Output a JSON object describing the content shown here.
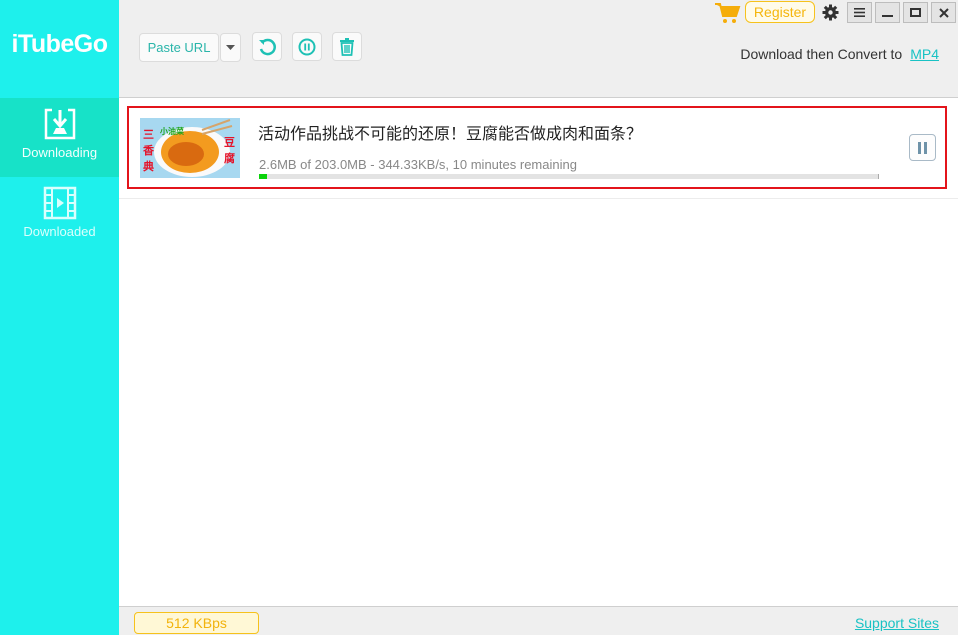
{
  "app": {
    "title": "iTubeGo"
  },
  "sidebar": {
    "items": [
      {
        "label": "Downloading",
        "icon": "download-icon",
        "active": true
      },
      {
        "label": "Downloaded",
        "icon": "film-icon",
        "active": false
      }
    ]
  },
  "toolbar": {
    "paste_url_label": "Paste URL",
    "dropdown_icon": "caret-down-icon",
    "retry_icon": "refresh-icon",
    "pause_all_icon": "pause-circle-icon",
    "delete_icon": "trash-icon"
  },
  "titlebar": {
    "cart_icon": "cart-icon",
    "register_label": "Register",
    "settings_icon": "gear-icon",
    "menu_icon": "hamburger-icon",
    "minimize_icon": "minimize-icon",
    "maximize_icon": "maximize-icon",
    "close_icon": "close-icon"
  },
  "convert": {
    "label": "Download then Convert to",
    "format": "MP4"
  },
  "downloads": [
    {
      "title": "活动作品挑战不可能的还原！豆腐能否做成肉和面条？",
      "status": "2.6MB of 203.0MB - 344.33KB/s, 10 minutes remaining",
      "progress_fraction": 0.013,
      "thumbnail_text": [
        "三香典",
        "小油菜",
        "豆腐"
      ]
    }
  ],
  "footer": {
    "speed_limit": "512 KBps",
    "support_label": "Support Sites"
  },
  "colors": {
    "sidebar": "#1ef0ec",
    "sidebar_active": "#17e2c8",
    "accent": "#19c2c4",
    "highlight_border": "#e3141b",
    "progress": "#0ad30a",
    "register": "#f6c21c"
  }
}
